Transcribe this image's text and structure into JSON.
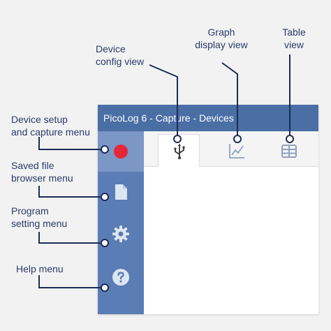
{
  "labels": {
    "device_config_view": "Device\nconfig view",
    "graph_display_view": "Graph\ndisplay view",
    "table_view": "Table\nview",
    "device_setup_menu": "Device setup\nand capture menu",
    "saved_file_menu": "Saved file\nbrowser menu",
    "program_setting_menu": "Program\nsetting menu",
    "help_menu": "Help menu"
  },
  "window": {
    "title": "PicoLog 6 - Capture - Devices"
  },
  "icons": {
    "capture": "record-icon",
    "file": "file-icon",
    "settings": "gear-icon",
    "help": "help-icon",
    "devices_tab": "usb-icon",
    "graph_tab": "line-chart-icon",
    "table_tab": "table-icon"
  },
  "colors": {
    "record": "#e8263a",
    "sidebar": "#5a7db5",
    "titlebar": "#4a6fa5",
    "callout": "#1e2a55"
  }
}
